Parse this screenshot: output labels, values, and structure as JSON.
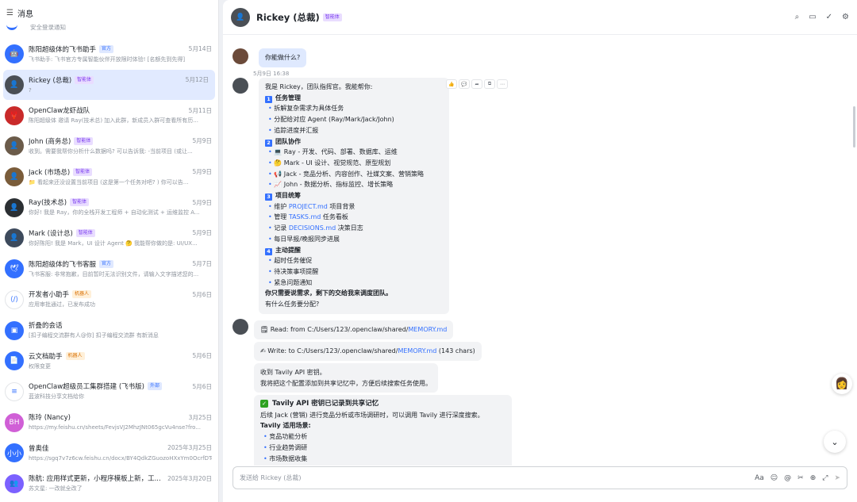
{
  "sidebar": {
    "title": "消息",
    "top_preview": "安全登录通知",
    "items": [
      {
        "name": "陈阳超级体的飞书助手",
        "badge": "官方",
        "badge_type": "off",
        "date": "5月14日",
        "preview": "飞书助手: 飞书官方专属智能伙伴开放限时体验! [名额先到先得]",
        "av": "bot",
        "color": "#3370ff"
      },
      {
        "name": "Rickey (总裁)",
        "badge": "智能体",
        "badge_type": "ai",
        "date": "5月12日",
        "preview": "?",
        "av": "photo",
        "color": "#4a4f55",
        "selected": true
      },
      {
        "name": "OpenClaw龙虾战队",
        "badge": "",
        "date": "5月11日",
        "preview": "陈阳超级体 邀请 Ray(技术总) 加入此群，新成员入群可查看所有历...",
        "av": "claw",
        "color": "#c92a2a"
      },
      {
        "name": "John (商务总)",
        "badge": "智能体",
        "badge_type": "ai",
        "date": "5月9日",
        "preview": "收到。需要我帮你分析什么数据吗? 可以告诉我: -当前项目 (或让...",
        "av": "photo",
        "color": "#6b5b4a"
      },
      {
        "name": "Jack (市场总)",
        "badge": "智能体",
        "badge_type": "ai",
        "date": "5月9日",
        "preview": "📁 看起来还没设置当前项目 (这是第一个任务对吧? ) 你可以告...",
        "av": "photo",
        "color": "#7a5c3a"
      },
      {
        "name": "Ray(技术总)",
        "badge": "智能体",
        "badge_type": "ai",
        "date": "5月9日",
        "preview": "你好! 我是 Ray，你的全栈开发工程师 + 自动化测试 + 运维监控 A...",
        "av": "photo",
        "color": "#2b2f33"
      },
      {
        "name": "Mark (设计总)",
        "badge": "智能体",
        "badge_type": "ai",
        "date": "5月9日",
        "preview": "你好陈阳! 我是 Mark，UI 设计 Agent 🤔 我能帮你做的是: UI/UX...",
        "av": "photo",
        "color": "#3d4a5c"
      },
      {
        "name": "陈阳超级体的飞书客服",
        "badge": "官方",
        "badge_type": "off",
        "date": "5月7日",
        "preview": "飞书客服: 非常抱歉，目前暂时无法识别文件，请输入文字描述您的...",
        "av": "svc",
        "color": "#3370ff"
      },
      {
        "name": "开发者小助手",
        "badge": "机器人",
        "badge_type": "bot",
        "date": "5月6日",
        "preview": "应用审批通过，已发布成功",
        "av": "dev",
        "color": "#ffffff"
      },
      {
        "name": "折叠的会话",
        "badge": "",
        "date": "",
        "preview": "[扣子编程交流群有人@你] 扣子编程交流群 有新消息",
        "av": "fold",
        "color": "#3370ff"
      },
      {
        "name": "云文档助手",
        "badge": "机器人",
        "badge_type": "bot",
        "date": "5月6日",
        "preview": "权限变更",
        "av": "doc",
        "color": "#3370ff"
      },
      {
        "name": "OpenClaw超级员工集群搭建 (飞书版)",
        "badge": "外部",
        "badge_type": "ext",
        "date": "5月6日",
        "preview": "蓝波科技分享文档给你",
        "av": "file",
        "color": "#ffffff"
      },
      {
        "name": "陈玲 (Nancy)",
        "badge": "",
        "date": "3月25日",
        "preview": "https://my.feishu.cn/sheets/FevjsVJ2MhzJNt065gcVu4nse?fro...",
        "av": "BH",
        "color": "#d05fd6"
      },
      {
        "name": "曾奥佳",
        "badge": "",
        "date": "2025年3月25日",
        "preview": "https://sgq7v7z6cw.feishu.cn/docx/BY4QdkZGuozoHXxYm0OcrfDTon...",
        "av": "小小",
        "color": "#3370ff"
      },
      {
        "name": "陈航: 应用样式更新，小程序模板上新，工...",
        "badge": "",
        "date": "2025年3月20日",
        "preview": "苏文星: 一改就全改了",
        "av": "grp",
        "color": "#7b61ff"
      }
    ]
  },
  "header": {
    "title": "Rickey (总裁)",
    "badge": "智能体"
  },
  "chat": {
    "user_msg": "你能做什么?",
    "timestamp": "5月9日 16:38",
    "reply": {
      "intro": "我是 Rickey，团队指挥官。我能帮你:",
      "s1": "任务管理",
      "s1_items": [
        "拆解复杂需求为具体任务",
        "分配给对应 Agent (Ray/Mark/Jack/John)",
        "追踪进度并汇报"
      ],
      "s2": "团队协作",
      "s2_items": [
        "💻 Ray - 开发、代码、部署、数据库、运维",
        "🤔 Mark - UI 设计、视觉规范、原型规划",
        "📢 Jack - 竞品分析、内容创作、社媒文案、营销策略",
        "📈 John - 数据分析、指标监控、增长策略"
      ],
      "s3": "项目统筹",
      "s3_items": [
        [
          "维护 ",
          "PROJECT.md",
          " 项目背景"
        ],
        [
          "管理 ",
          "TASKS.md",
          " 任务看板"
        ],
        [
          "记录 ",
          "DECISIONS.md",
          " 决策日志"
        ],
        [
          "每日早报/晚报同步进展",
          "",
          ""
        ]
      ],
      "s4": "主动提醒",
      "s4_items": [
        "超时任务催促",
        "待决策事项提醒",
        "紧急问题通知"
      ],
      "outro_bold": "你只需要说需求，剩下的交给我来调度团队。",
      "outro": "有什么任务要分配?"
    },
    "read": {
      "pre": "Read: from C:/Users/123/.openclaw/shared/",
      "link": "MEMORY.md"
    },
    "write": {
      "pre": "Write: to C:/Users/123/.openclaw/shared/",
      "link": "MEMORY.md",
      "post": " (143 chars)"
    },
    "tavily1": "收到 Tavily API 密钥。",
    "tavily2": "我将把这个配置添加到共享记忆中，方便后续搜索任务使用。",
    "card_title": "Tavily API 密钥已记录到共享记忆",
    "card_line": "后续 Jack (营销) 进行竞品分析或市场调研时，可以调用 Tavily 进行深度搜索。",
    "card_sub": "Tavily 适用场景:",
    "card_items": [
      "竞品功能分析",
      "行业趋势调研",
      "市场数据收集",
      "用户反馈挖掘"
    ]
  },
  "input": {
    "placeholder": "发送给 Rickey (总裁)"
  }
}
